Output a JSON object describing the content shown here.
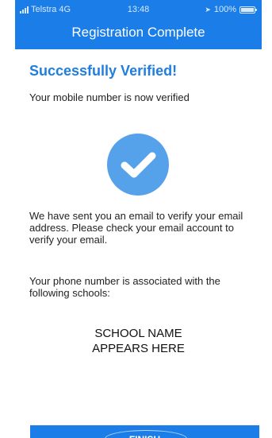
{
  "status_bar": {
    "carrier": "Telstra",
    "network": "4G",
    "time": "13:48",
    "battery": "100%",
    "icons": [
      "signal-icon",
      "location-icon",
      "battery-icon"
    ]
  },
  "nav": {
    "title": "Registration Complete"
  },
  "main": {
    "heading": "Successfully Verified!",
    "verified_text": "Your mobile number is now verified",
    "check_icon": "checkmark-circle-icon",
    "email_text": "We have sent you an email to verify your email address. Please check your email account to verify your email.",
    "schools_text": "Your phone number is associated with the following schools:",
    "school_name": "SCHOOL NAME\nAPPEARS HERE"
  },
  "actions": {
    "finish_label": "FINISH"
  },
  "colors": {
    "accent": "#1A7DE8",
    "heading": "#1F7EE0",
    "check_circle": "#56A2EA",
    "background": "#FFFFFF"
  }
}
